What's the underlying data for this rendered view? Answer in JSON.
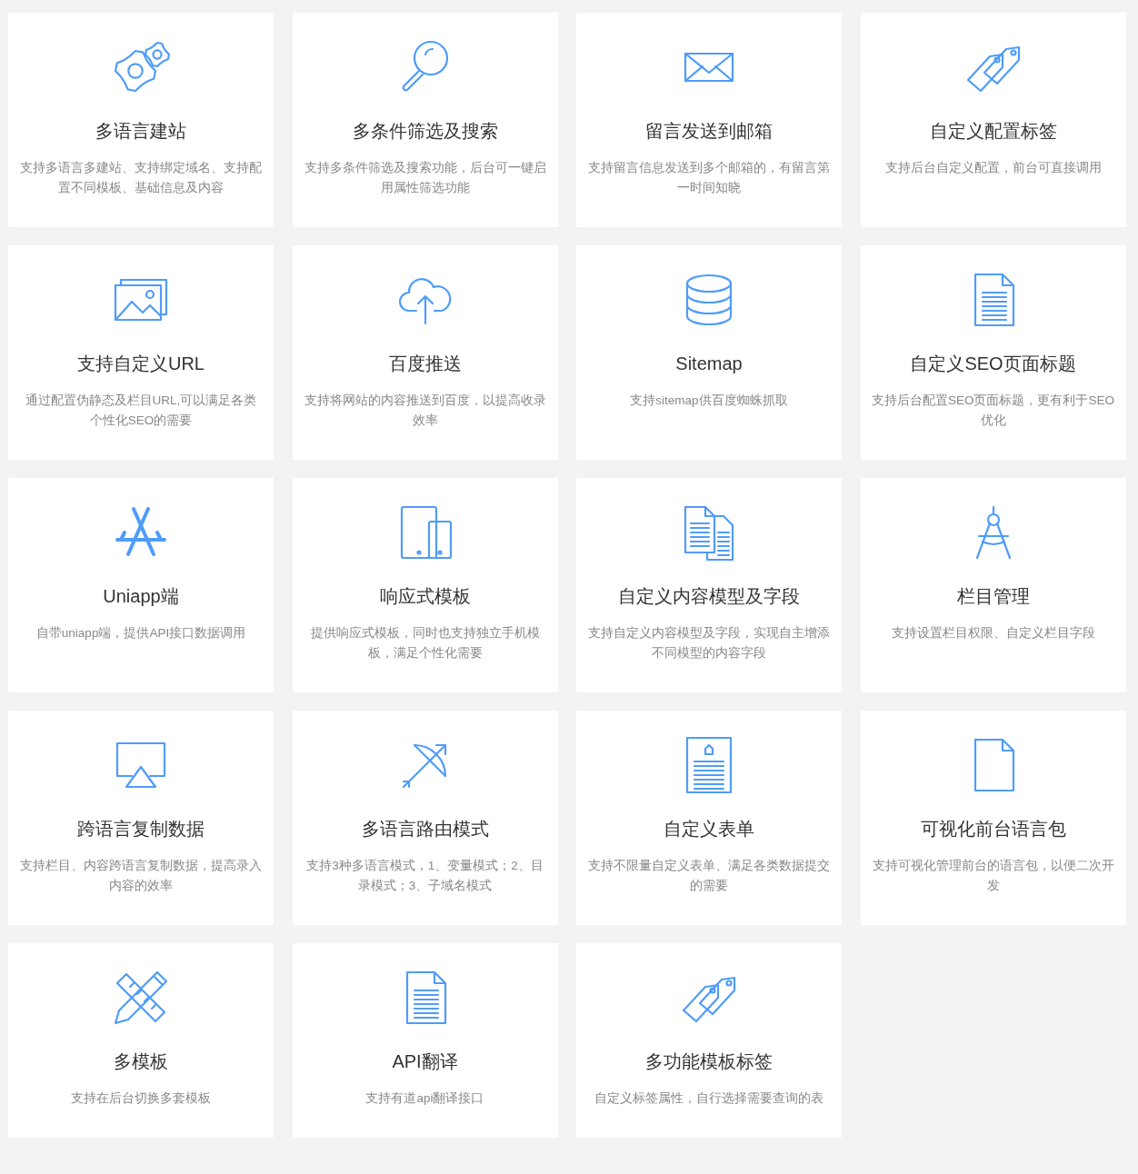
{
  "features": [
    {
      "title": "多语言建站",
      "description": "支持多语言多建站、支持绑定域名、支持配置不同模板、基础信息及内容"
    },
    {
      "title": "多条件筛选及搜索",
      "description": "支持多条件筛选及搜索功能，后台可一键启用属性筛选功能"
    },
    {
      "title": "留言发送到邮箱",
      "description": "支持留言信息发送到多个邮箱的，有留言第一时间知晓"
    },
    {
      "title": "自定义配置标签",
      "description": "支持后台自定义配置，前台可直接调用"
    },
    {
      "title": "支持自定义URL",
      "description": "通过配置伪静态及栏目URL,可以满足各类个性化SEO的需要"
    },
    {
      "title": "百度推送",
      "description": "支持将网站的内容推送到百度，以提高收录效率"
    },
    {
      "title": "Sitemap",
      "description": "支持sitemap供百度蜘蛛抓取"
    },
    {
      "title": "自定义SEO页面标题",
      "description": "支持后台配置SEO页面标题，更有利于SEO优化"
    },
    {
      "title": "Uniapp端",
      "description": "自带uniapp端，提供API接口数据调用"
    },
    {
      "title": "响应式模板",
      "description": "提供响应式模板，同时也支持独立手机模板，满足个性化需要"
    },
    {
      "title": "自定义内容模型及字段",
      "description": "支持自定义内容模型及字段，实现自主增添不同模型的内容字段"
    },
    {
      "title": "栏目管理",
      "description": "支持设置栏目权限、自定义栏目字段"
    },
    {
      "title": "跨语言复制数据",
      "description": "支持栏目、内容跨语言复制数据，提高录入内容的效率"
    },
    {
      "title": "多语言路由模式",
      "description": "支持3种多语言模式，1、变量模式；2、目录模式；3、子域名模式"
    },
    {
      "title": "自定义表单",
      "description": "支持不限量自定义表单、满足各类数据提交的需要"
    },
    {
      "title": "可视化前台语言包",
      "description": "支持可视化管理前台的语言包，以便二次开发"
    },
    {
      "title": "多模板",
      "description": "支持在后台切换多套模板"
    },
    {
      "title": "API翻译",
      "description": "支持有道api翻译接口"
    },
    {
      "title": "多功能模板标签",
      "description": "自定义标签属性，自行选择需要查询的表"
    }
  ]
}
